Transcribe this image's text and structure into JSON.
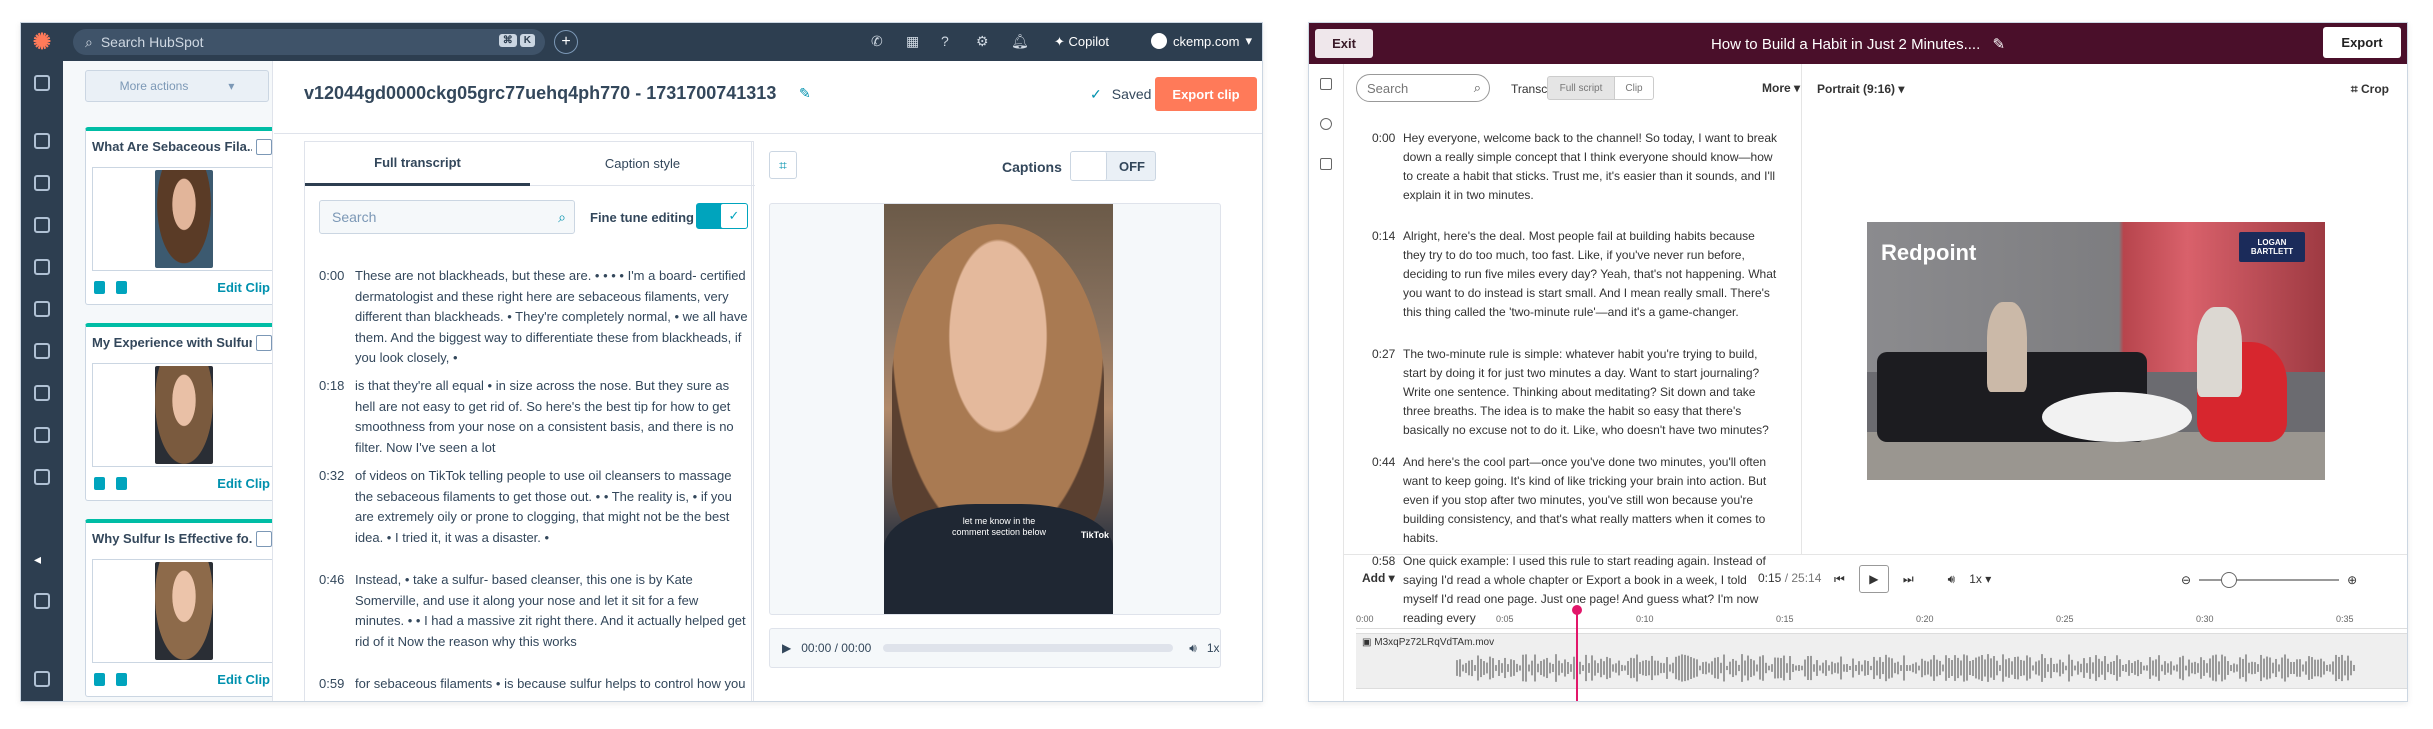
{
  "hubspot": {
    "search_placeholder": "Search HubSpot",
    "search_kbd1": "⌘",
    "search_kbd2": "K",
    "copilot": "Copilot",
    "account": "ckemp.com",
    "more_actions": "More actions",
    "clips": [
      {
        "title": "What Are Sebaceous Fila...",
        "edit": "Edit Clip"
      },
      {
        "title": "My Experience with Sulfur...",
        "edit": "Edit Clip"
      },
      {
        "title": "Why Sulfur Is Effective fo...",
        "edit": "Edit Clip"
      }
    ],
    "clip_title": "v12044gd0000ckg05grc77uehq4ph770 - 1731700741313",
    "saved": "Saved",
    "export_clip": "Export clip",
    "tab_full_transcript": "Full transcript",
    "tab_caption_style": "Caption style",
    "search_placeholder2": "Search",
    "fine_tune_editing": "Fine tune editing",
    "captions_label": "Captions",
    "captions_state": "OFF",
    "video_caption": "let me know in the comment section below",
    "tiktok": "TikTok",
    "player_time": "00:00 / 00:00",
    "player_speed": "1x",
    "transcript": [
      {
        "t": "0:00",
        "text": "These are not blackheads, but these are. • • • • I'm a board- certified dermatologist and these right here are sebaceous filaments, very different than blackheads. • They're completely normal, • we all have them. And the biggest way to differentiate these from blackheads, if you look closely, •"
      },
      {
        "t": "0:18",
        "text": "is that they're all equal • in size across the nose. But they sure as hell are not easy to get rid of. So here's the best tip for how to get smoothness from your nose on a consistent basis, and there is no filter. Now I've seen a lot"
      },
      {
        "t": "0:32",
        "text": "of videos on TikTok telling people to use oil cleansers to massage the sebaceous filaments to get those out. • • The reality is, • if you are extremely oily or prone to clogging, that might not be the best idea. • I tried it, it was a disaster. •"
      },
      {
        "t": "0:46",
        "text": "Instead, • take a sulfur- based cleanser, this one is by Kate Somerville, and use it along your nose and let it sit for a few minutes. • • I had a massive zit right there. And it actually helped get rid of it Now the reason why this works"
      },
      {
        "t": "0:59",
        "text": "for sebaceous filaments • is because sulfur helps to control how you"
      }
    ]
  },
  "editor": {
    "exit": "Exit",
    "title": "How to Build a Habit in Just 2 Minutes....",
    "export": "Export",
    "search_placeholder": "Search",
    "transcript_label": "Transcript",
    "full_script": "Full script",
    "clip": "Clip",
    "more": "More",
    "portrait": "Portrait (9:16)",
    "crop": "Crop",
    "video_brand": "Redpoint",
    "video_logo": "LOGAN BARTLETT",
    "add": "Add",
    "time_current": "0:15",
    "time_total": "/ 25:14",
    "speed": "1x",
    "filename": "M3xqPz72LRqVdTAm.mov",
    "ruler": [
      "0:00",
      "0:05",
      "0:10",
      "0:15",
      "0:20",
      "0:25",
      "0:30",
      "0:35"
    ],
    "transcript": [
      {
        "t": "0:00",
        "text": "Hey everyone, welcome back to the channel! So today, I want to break down a really simple concept that I think everyone should know—how to create a habit that sticks. Trust me, it's easier than it sounds, and I'll explain it in two minutes."
      },
      {
        "t": "0:14",
        "text": "Alright, here's the deal. Most people fail at building habits because they try to do too much, too fast. Like, if you've never run before, deciding to run five miles every day? Yeah, that's not happening. What you want to do instead is start small. And I mean really small. There's this thing called the 'two-minute rule'—and it's a game-changer."
      },
      {
        "t": "0:27",
        "text": "The two-minute rule is simple: whatever habit you're trying to build, start by doing it for just two minutes a day. Want to start journaling? Write one sentence. Thinking about meditating? Sit down and take three breaths. The idea is to make the habit so easy that there's basically no excuse not to do it. Like, who doesn't have two minutes?"
      },
      {
        "t": "0:44",
        "text": "And here's the cool part—once you've done two minutes, you'll often want to keep going. It's kind of like tricking your brain into action. But even if you stop after two minutes, you've still won because you're building consistency, and that's what really matters when it comes to habits."
      },
      {
        "t": "0:58",
        "text": "One quick example: I used this rule to start reading again. Instead of saying I'd read a whole chapter or Export a book in a week, I told myself I'd read one page. Just one page! And guess what? I'm now reading every"
      }
    ]
  }
}
